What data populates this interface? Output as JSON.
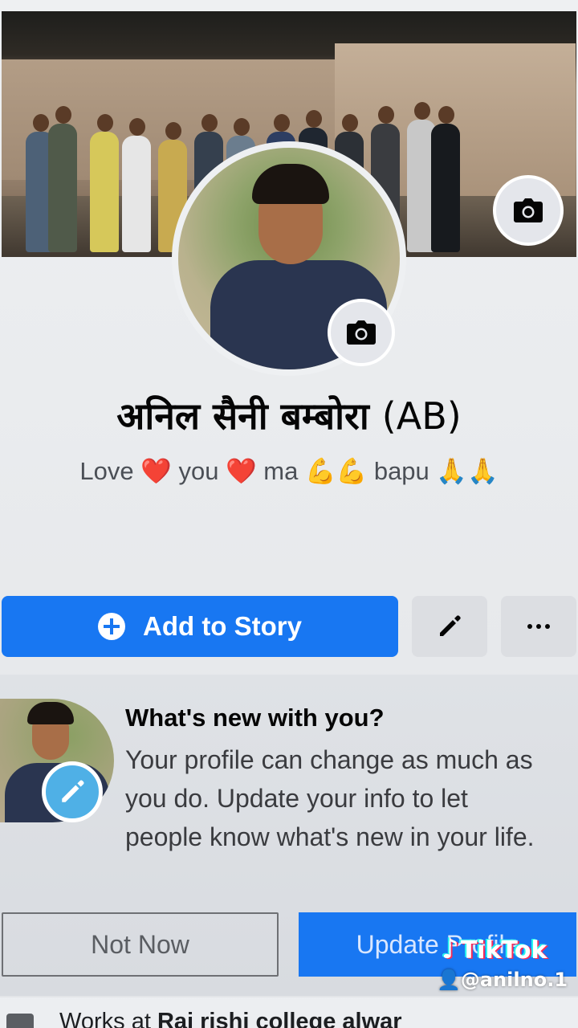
{
  "profile": {
    "name_devanagari": "अनिल सैनी बम्बोरा",
    "name_suffix": "(AB)",
    "bio": {
      "w1": "Love",
      "heart1": "❤️",
      "w2": "you",
      "heart2": "❤️",
      "w3": "ma",
      "muscle": "💪💪",
      "w4": "bapu",
      "pray": "🙏🙏"
    }
  },
  "actions": {
    "add_story_label": "Add to Story",
    "edit_icon": "pencil-icon",
    "more_icon": "more-dots-icon"
  },
  "prompt_card": {
    "title": "What's new with you?",
    "body": "Your profile can change as much as you do. Update your info to let people know what's new in your life.",
    "not_now_label": "Not Now",
    "update_label": "Update Profile"
  },
  "works": {
    "prefix": "Works at",
    "place": "Raj rishi college alwar"
  },
  "watermark": {
    "brand": "TikTok",
    "user": "@anilno.1"
  },
  "colors": {
    "primary": "#1877f2",
    "heart": "#e0162b",
    "badge": "#4fb0e6"
  }
}
